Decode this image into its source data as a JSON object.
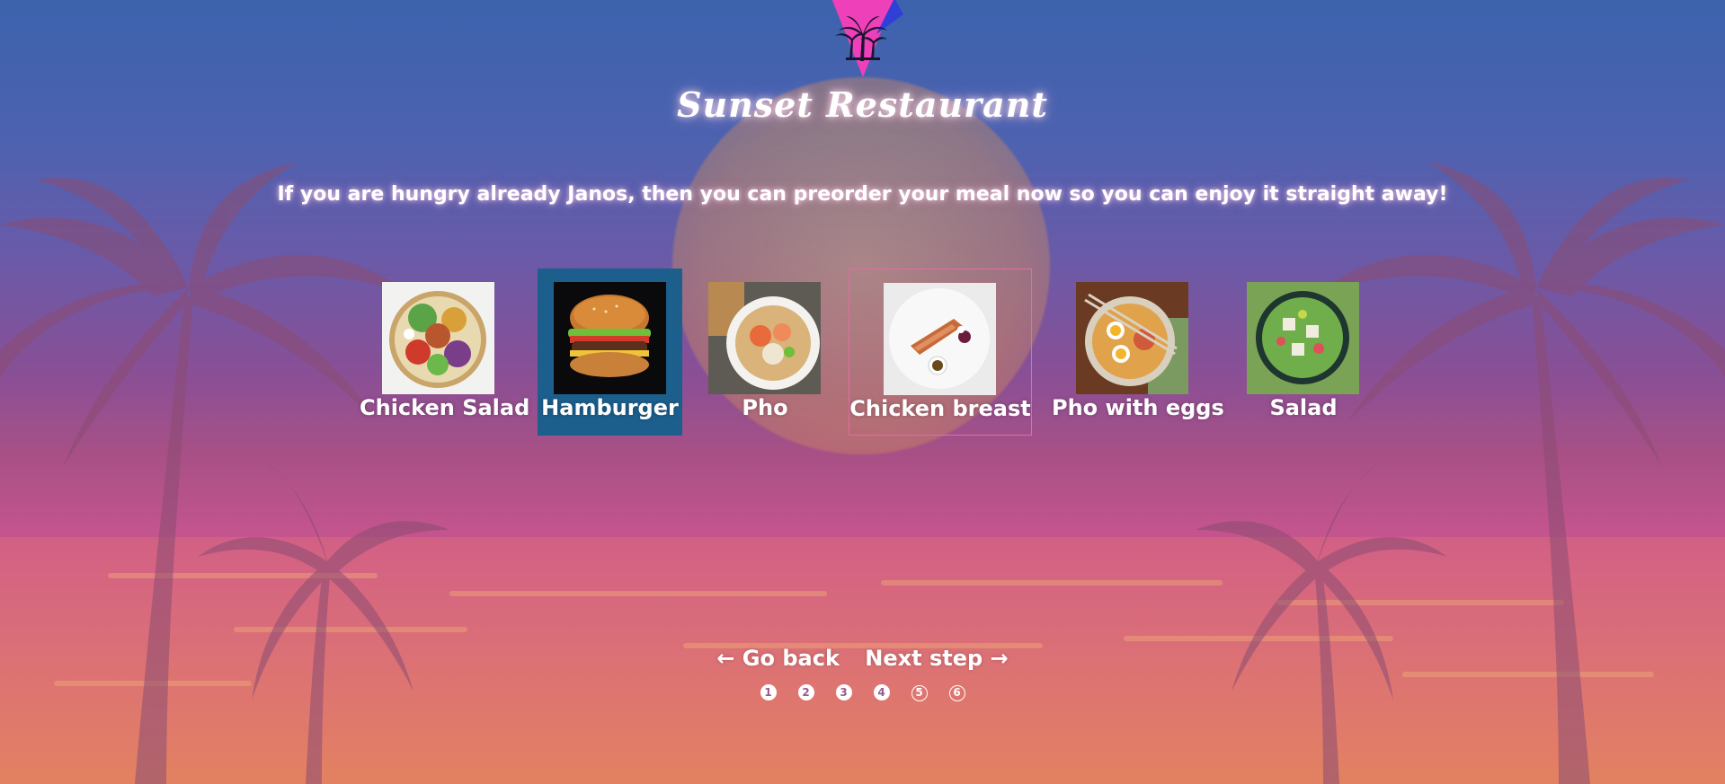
{
  "app": {
    "title": "Sunset Restaurant",
    "subtitle": "If you are hungry already Janos, then you can preorder your meal now so you can enjoy it straight away!"
  },
  "menu": {
    "items": [
      {
        "label": "Chicken Salad",
        "state": "normal"
      },
      {
        "label": "Hamburger",
        "state": "selected"
      },
      {
        "label": "Pho",
        "state": "normal"
      },
      {
        "label": "Chicken breast",
        "state": "hovered"
      },
      {
        "label": "Pho with eggs",
        "state": "normal"
      },
      {
        "label": "Salad",
        "state": "normal"
      }
    ]
  },
  "nav": {
    "back_label": "← Go back",
    "next_label": "Next step →"
  },
  "steps": {
    "items": [
      {
        "label": "1",
        "status": "done"
      },
      {
        "label": "2",
        "status": "done"
      },
      {
        "label": "3",
        "status": "done"
      },
      {
        "label": "4",
        "status": "done"
      },
      {
        "label": "5",
        "status": "todo"
      },
      {
        "label": "6",
        "status": "todo"
      }
    ]
  },
  "colors": {
    "selected_card": "#1c5e8c",
    "hover_border": "#e86aa6",
    "sky_top": "#3c63ad",
    "sky_bottom": "#de7e63"
  },
  "icons": {
    "logo": "palm-triangle-logo"
  }
}
